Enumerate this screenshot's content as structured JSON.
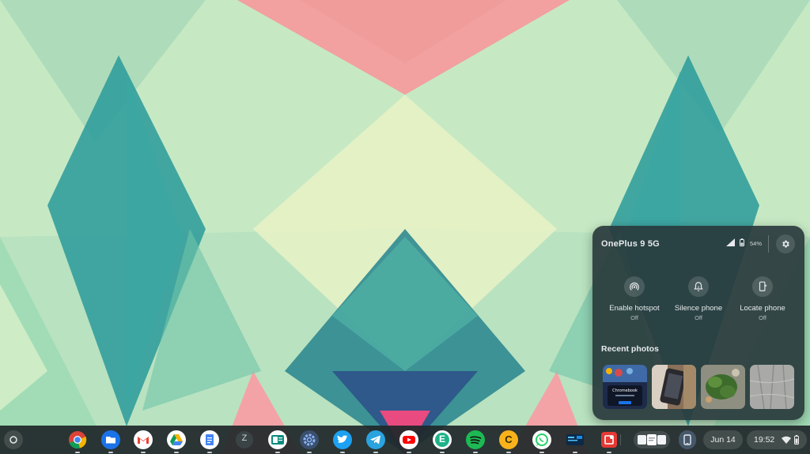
{
  "phone_hub": {
    "device_name": "OnePlus 9 5G",
    "battery_percent": "54%",
    "features": [
      {
        "label": "Enable hotspot",
        "state": "Off",
        "icon": "hotspot-icon"
      },
      {
        "label": "Silence phone",
        "state": "Off",
        "icon": "silence-bell-icon"
      },
      {
        "label": "Locate phone",
        "state": "Off",
        "icon": "locate-phone-icon"
      }
    ],
    "recent_photos_title": "Recent photos",
    "thumbnail_text": "Chromebook"
  },
  "shelf": {
    "apps": [
      {
        "name": "Chrome",
        "icon": "chrome-icon"
      },
      {
        "name": "Files",
        "icon": "files-icon"
      },
      {
        "name": "Gmail",
        "icon": "gmail-icon"
      },
      {
        "name": "Google Drive",
        "icon": "drive-icon"
      },
      {
        "name": "Google Docs",
        "icon": "docs-icon"
      },
      {
        "name": "Zeal",
        "icon": "z-icon",
        "letter": "Z"
      },
      {
        "name": "Outlook",
        "icon": "outlook-icon"
      },
      {
        "name": "Settings",
        "icon": "settings-gear-icon"
      },
      {
        "name": "Twitter",
        "icon": "twitter-icon"
      },
      {
        "name": "Telegram",
        "icon": "telegram-icon"
      },
      {
        "name": "YouTube",
        "icon": "youtube-icon"
      },
      {
        "name": "E",
        "icon": "e-app-icon",
        "letter": "E"
      },
      {
        "name": "Spotify",
        "icon": "spotify-icon"
      },
      {
        "name": "C",
        "icon": "c-app-icon",
        "letter": "C"
      },
      {
        "name": "WhatsApp",
        "icon": "whatsapp-icon"
      },
      {
        "name": "News",
        "icon": "news-app-icon"
      },
      {
        "name": "Screenshot",
        "icon": "red-app-icon"
      }
    ],
    "date": "Jun 14",
    "time": "19:52"
  },
  "colors": {
    "panel_bg": "#283a3c",
    "shelf_bg": "#20282a",
    "text": "#e8eaed"
  }
}
